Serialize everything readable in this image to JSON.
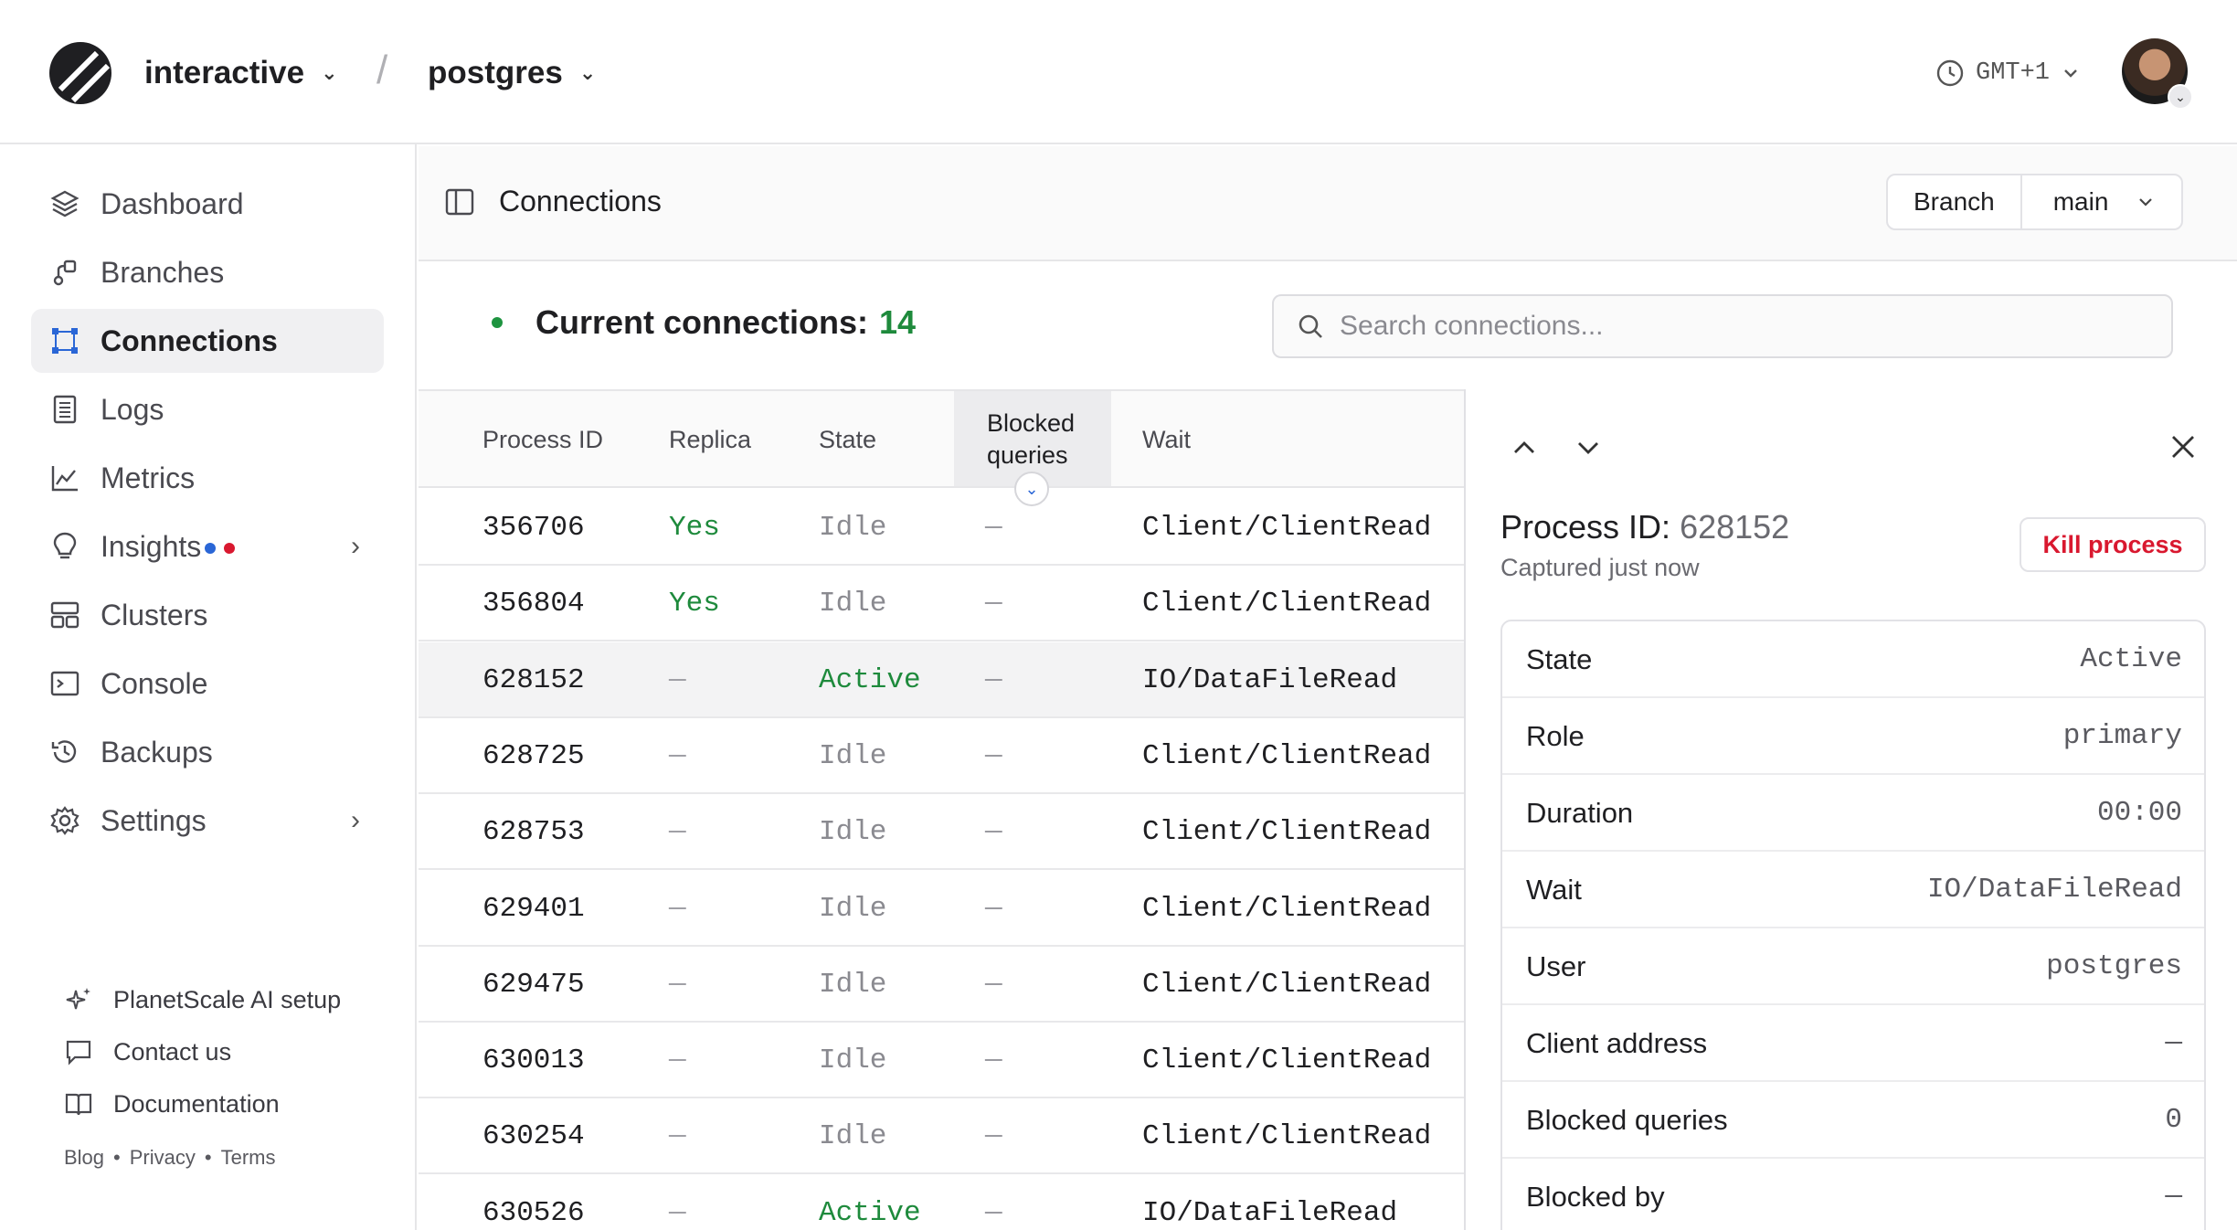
{
  "header": {
    "org_name": "interactive",
    "database_name": "postgres",
    "separator": "/",
    "timezone": "GMT+1"
  },
  "sidebar": {
    "items": [
      {
        "label": "Dashboard",
        "icon": "layers-icon"
      },
      {
        "label": "Branches",
        "icon": "branch-icon"
      },
      {
        "label": "Connections",
        "icon": "connections-icon",
        "active": true
      },
      {
        "label": "Logs",
        "icon": "logs-icon"
      },
      {
        "label": "Metrics",
        "icon": "metrics-icon"
      },
      {
        "label": "Insights",
        "icon": "lightbulb-icon",
        "has_submenu": true
      },
      {
        "label": "Clusters",
        "icon": "clusters-icon"
      },
      {
        "label": "Console",
        "icon": "terminal-icon"
      },
      {
        "label": "Backups",
        "icon": "backup-icon"
      },
      {
        "label": "Settings",
        "icon": "gear-icon",
        "has_submenu": true
      }
    ],
    "footer_links": [
      {
        "label": "PlanetScale AI setup",
        "icon": "sparkle-icon"
      },
      {
        "label": "Contact us",
        "icon": "chat-icon"
      },
      {
        "label": "Documentation",
        "icon": "book-icon"
      }
    ],
    "legal": [
      "Blog",
      "Privacy",
      "Terms"
    ],
    "legal_separator": "•",
    "insight_dot_colors": [
      "#2a66d6",
      "#d9182f"
    ]
  },
  "page": {
    "title": "Connections",
    "branch_label": "Branch",
    "branch_value": "main"
  },
  "stats": {
    "label": "Current connections:",
    "count": "14"
  },
  "search": {
    "placeholder": "Search connections...",
    "value": ""
  },
  "table": {
    "columns": [
      "Process ID",
      "Replica",
      "State",
      "Blocked queries",
      "Wait"
    ],
    "sorted_column": "Blocked queries",
    "rows": [
      {
        "pid": "356706",
        "replica": "Yes",
        "state": "Idle",
        "blocked": "—",
        "wait": "Client/ClientRead"
      },
      {
        "pid": "356804",
        "replica": "Yes",
        "state": "Idle",
        "blocked": "—",
        "wait": "Client/ClientRead"
      },
      {
        "pid": "628152",
        "replica": "—",
        "state": "Active",
        "blocked": "—",
        "wait": "IO/DataFileRead",
        "selected": true
      },
      {
        "pid": "628725",
        "replica": "—",
        "state": "Idle",
        "blocked": "—",
        "wait": "Client/ClientRead"
      },
      {
        "pid": "628753",
        "replica": "—",
        "state": "Idle",
        "blocked": "—",
        "wait": "Client/ClientRead"
      },
      {
        "pid": "629401",
        "replica": "—",
        "state": "Idle",
        "blocked": "—",
        "wait": "Client/ClientRead"
      },
      {
        "pid": "629475",
        "replica": "—",
        "state": "Idle",
        "blocked": "—",
        "wait": "Client/ClientRead"
      },
      {
        "pid": "630013",
        "replica": "—",
        "state": "Idle",
        "blocked": "—",
        "wait": "Client/ClientRead"
      },
      {
        "pid": "630254",
        "replica": "—",
        "state": "Idle",
        "blocked": "—",
        "wait": "Client/ClientRead"
      },
      {
        "pid": "630526",
        "replica": "—",
        "state": "Active",
        "blocked": "—",
        "wait": "IO/DataFileRead"
      }
    ]
  },
  "detail": {
    "title_label": "Process ID:",
    "title_value": "628152",
    "subtitle": "Captured just now",
    "kill_label": "Kill process",
    "fields": [
      {
        "key": "State",
        "value": "Active"
      },
      {
        "key": "Role",
        "value": "primary"
      },
      {
        "key": "Duration",
        "value": "00:00"
      },
      {
        "key": "Wait",
        "value": "IO/DataFileRead"
      },
      {
        "key": "User",
        "value": "postgres"
      },
      {
        "key": "Client address",
        "value": "—"
      },
      {
        "key": "Blocked queries",
        "value": "0"
      },
      {
        "key": "Blocked by",
        "value": "—"
      }
    ]
  },
  "colors": {
    "accent_green": "#1e8a3c",
    "danger_red": "#d9182f",
    "link_blue": "#2a66d6"
  }
}
